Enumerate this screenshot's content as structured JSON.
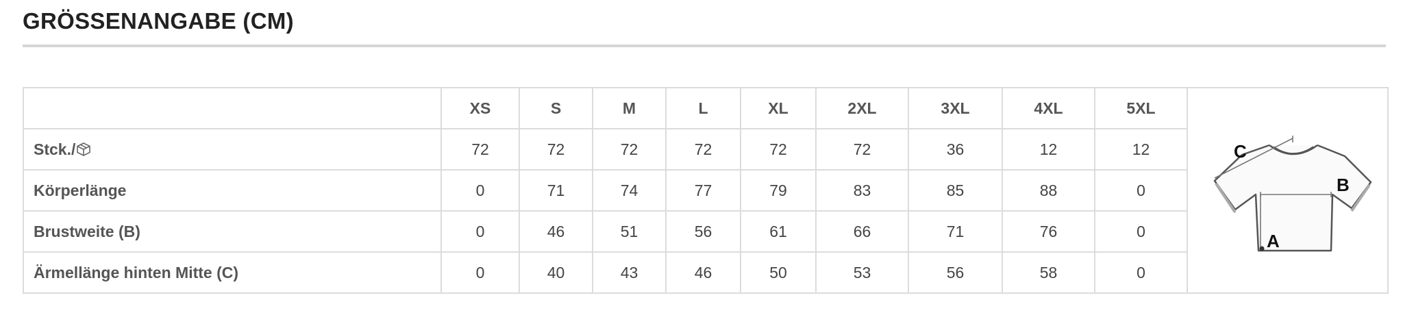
{
  "title": "GRÖSSENANGABE (CM)",
  "sizes": [
    "XS",
    "S",
    "M",
    "L",
    "XL",
    "2XL",
    "3XL",
    "4XL",
    "5XL"
  ],
  "rows": [
    {
      "label": "Stck./",
      "icon": "box-icon",
      "values": [
        "72",
        "72",
        "72",
        "72",
        "72",
        "72",
        "36",
        "12",
        "12"
      ]
    },
    {
      "label": "Körperlänge",
      "values": [
        "0",
        "71",
        "74",
        "77",
        "79",
        "83",
        "85",
        "88",
        "0"
      ]
    },
    {
      "label": "Brustweite (B)",
      "values": [
        "0",
        "46",
        "51",
        "56",
        "61",
        "66",
        "71",
        "76",
        "0"
      ]
    },
    {
      "label": "Ärmellänge hinten Mitte (C)",
      "values": [
        "0",
        "40",
        "43",
        "46",
        "50",
        "53",
        "56",
        "58",
        "0"
      ]
    }
  ],
  "diagram": {
    "icon": "tshirt-measurement-diagram",
    "labels": {
      "a": "A",
      "b": "B",
      "c": "C"
    }
  }
}
